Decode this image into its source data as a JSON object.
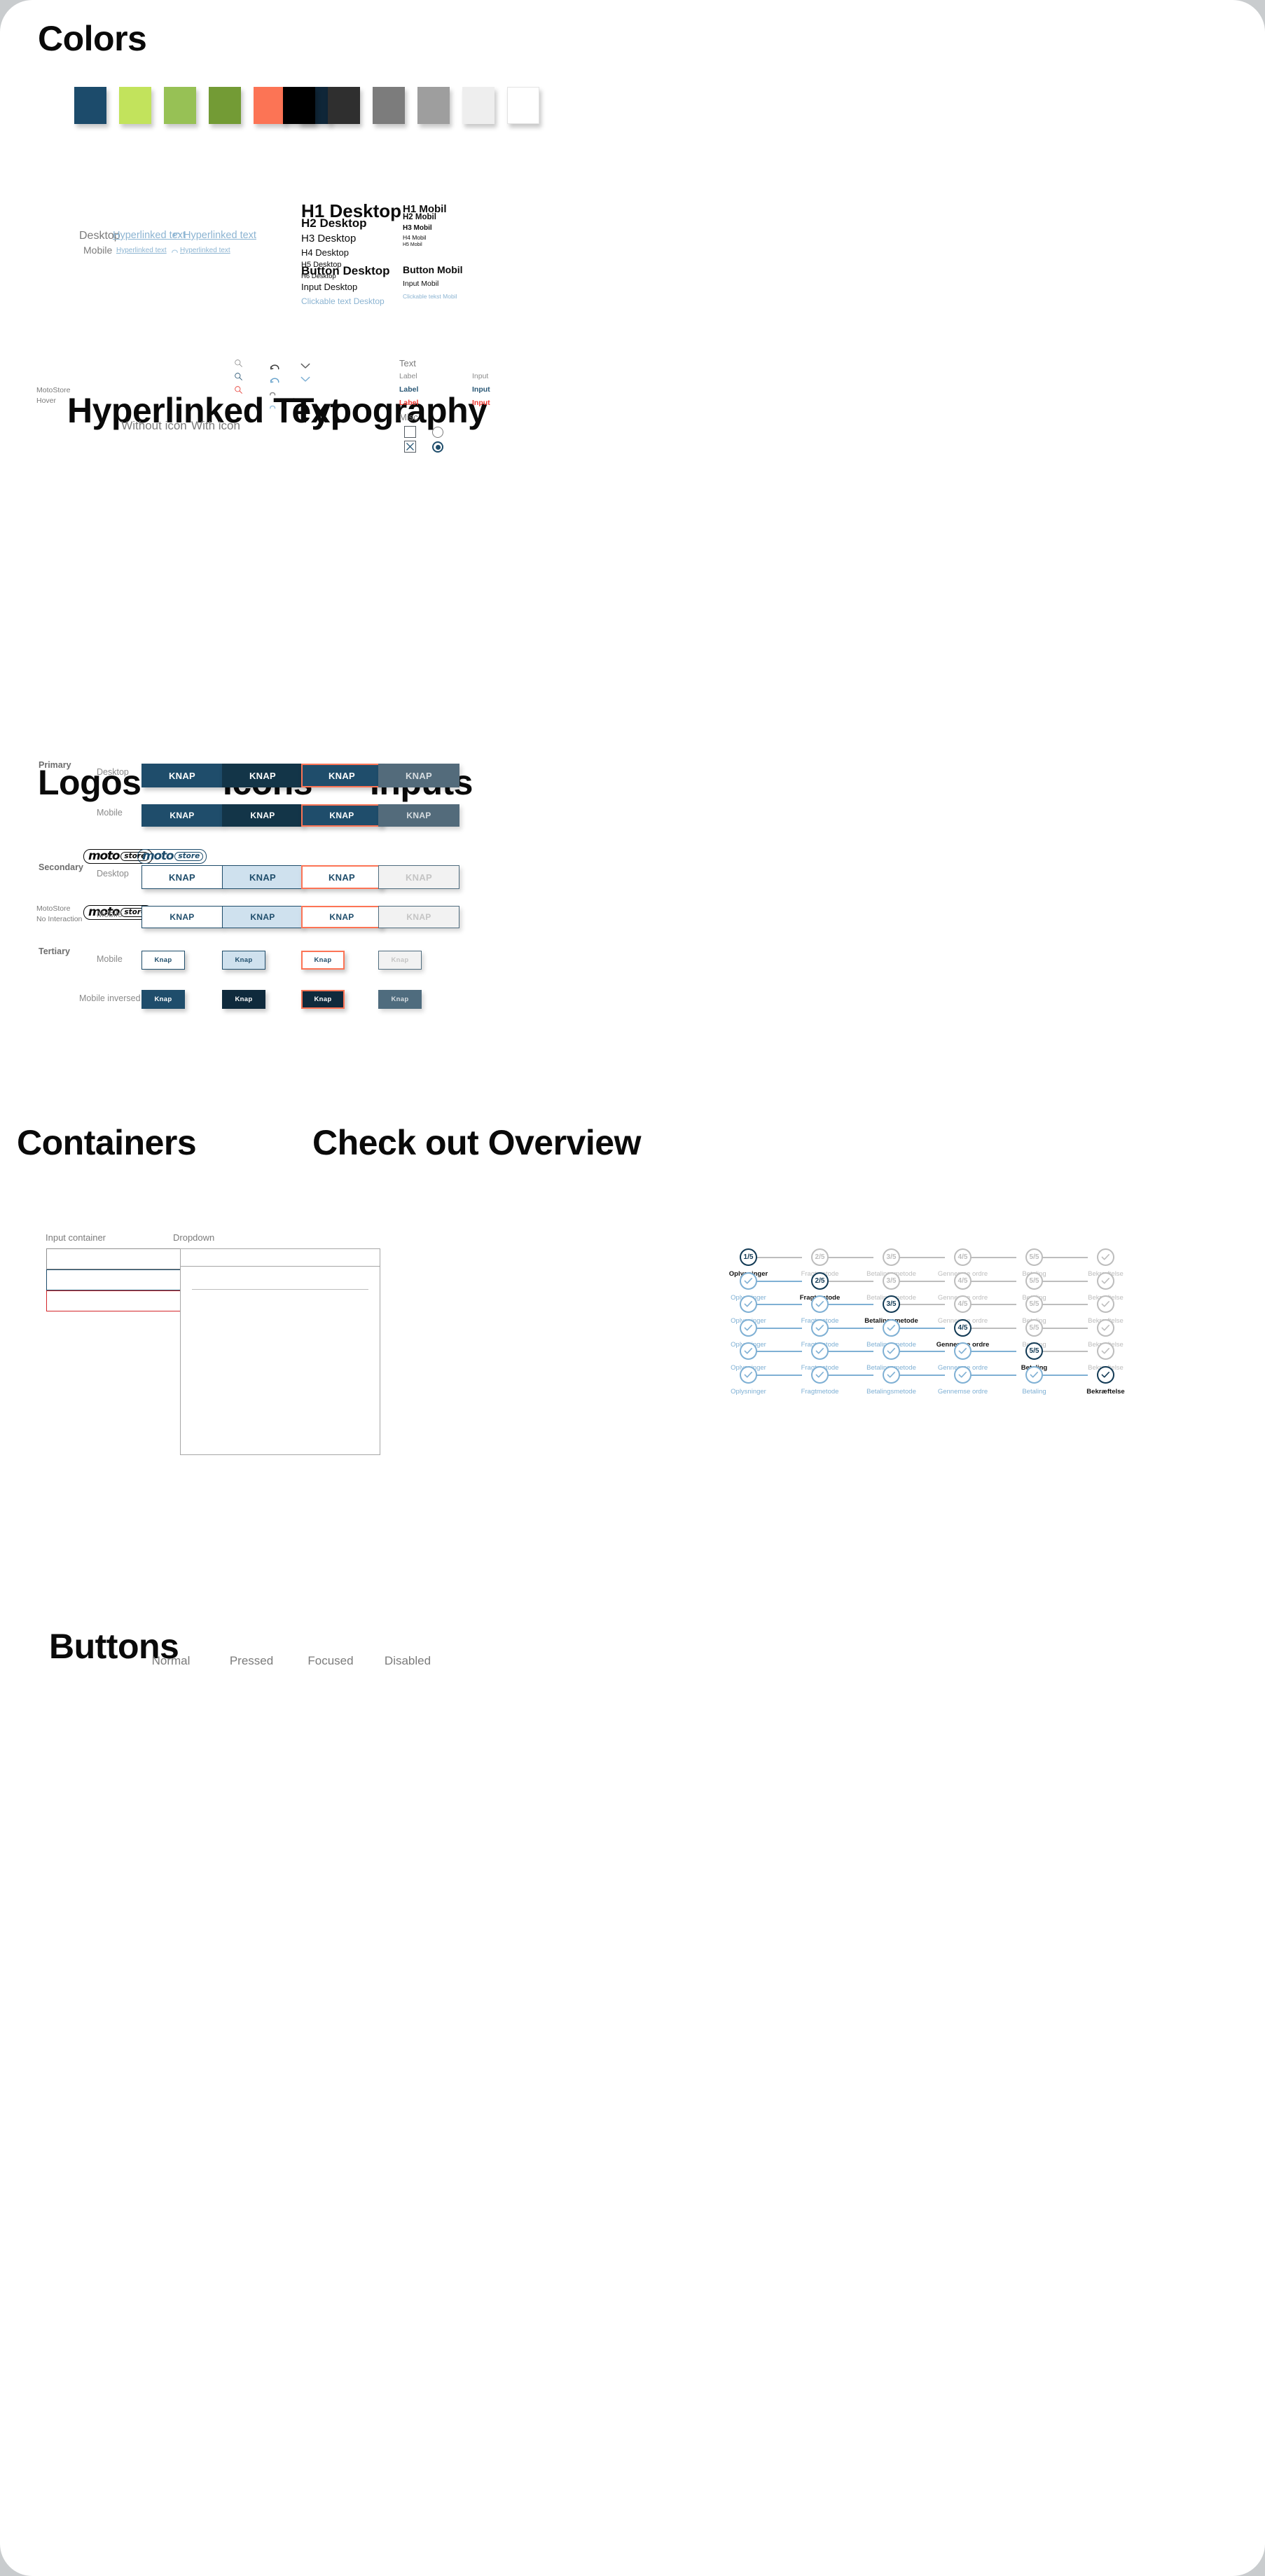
{
  "sections": {
    "colors": "Colors",
    "hyperlinked": "Hyperlinked Text",
    "typography": "Typography",
    "logos": "Logos",
    "icons": "Icons",
    "inputs": "Inputs",
    "containers": "Containers",
    "checkout": "Check out Overview",
    "buttons": "Buttons"
  },
  "colors": {
    "brand": [
      {
        "name": "navy-blue",
        "hex": "#1c4b6b"
      },
      {
        "name": "lime-green",
        "hex": "#c2e35c"
      },
      {
        "name": "apple-green",
        "hex": "#97c155"
      },
      {
        "name": "olive-green",
        "hex": "#739b35"
      },
      {
        "name": "coral-orange",
        "hex": "#fc7455"
      },
      {
        "name": "dark-navy",
        "hex": "#0f2638"
      }
    ],
    "neutrals": [
      {
        "name": "black",
        "hex": "#000000"
      },
      {
        "name": "near-black",
        "hex": "#2f2f2f"
      },
      {
        "name": "dark-grey",
        "hex": "#7c7c7c"
      },
      {
        "name": "mid-grey",
        "hex": "#9e9e9e"
      },
      {
        "name": "light-grey",
        "hex": "#eeeeee"
      },
      {
        "name": "white",
        "hex": "#ffffff"
      }
    ]
  },
  "hyperlinked": {
    "col_without": "Without icon",
    "col_with": "With icon",
    "row_desktop": "Desktop",
    "row_mobile": "Mobile",
    "link_text": "Hyperlinked text",
    "link_color": "#8cb4d2"
  },
  "typography": {
    "desktop": [
      {
        "label": "H1 Desktop",
        "size": 26,
        "weight": 700
      },
      {
        "label": "H2 Desktop",
        "size": 17,
        "weight": 700
      },
      {
        "label": "H3 Desktop",
        "size": 15,
        "weight": 400
      },
      {
        "label": "H4 Desktop",
        "size": 13,
        "weight": 400
      },
      {
        "label": "H5 Desktop",
        "size": 11,
        "weight": 400
      },
      {
        "label": "H6 Desktop",
        "size": 9.5,
        "weight": 400
      }
    ],
    "desktop_extra": [
      {
        "label": "Button Desktop",
        "size": 17,
        "weight": 700,
        "color": "#0c0c0c"
      },
      {
        "label": "Input Desktop",
        "size": 13,
        "weight": 400,
        "color": "#0c0c0c"
      },
      {
        "label": "Clickable text Desktop",
        "size": 12,
        "weight": 400,
        "color": "#8cb4d2"
      }
    ],
    "mobile": [
      {
        "label": "H1 Mobil",
        "size": 15,
        "weight": 700
      },
      {
        "label": "H2 Mobil",
        "size": 11.5,
        "weight": 700
      },
      {
        "label": "H3 Mobil",
        "size": 10,
        "weight": 700
      },
      {
        "label": "H4 Mobil",
        "size": 8.5,
        "weight": 400
      },
      {
        "label": "H5 Mobil",
        "size": 7,
        "weight": 400
      }
    ],
    "mobile_extra": [
      {
        "label": "Button Mobil",
        "size": 14,
        "weight": 700,
        "color": "#0c0c0c"
      },
      {
        "label": "Input Mobil",
        "size": 10.5,
        "weight": 400,
        "color": "#0c0c0c"
      },
      {
        "label": "Clickable tekst Mobil",
        "size": 8.5,
        "weight": 400,
        "color": "#8cb4d2"
      }
    ]
  },
  "logos": {
    "row_hover": "MotoStore\nHover",
    "row_hover_l1": "MotoStore",
    "row_hover_l2": "Hover",
    "row_none_l1": "MotoStore",
    "row_none_l2": "No Interaction",
    "wordmark": "moto",
    "badge": "store",
    "black": "#0a0a0a",
    "blue": "#1c4b6b"
  },
  "icons": {
    "search": [
      {
        "name": "search-icon-grey",
        "color": "#8a8a8a"
      },
      {
        "name": "search-icon-navy",
        "color": "#1c4b6b"
      },
      {
        "name": "search-icon-red",
        "color": "#e5332a"
      }
    ],
    "undo": [
      {
        "name": "undo-icon-dark",
        "color": "#3b3b3b",
        "scale": 1
      },
      {
        "name": "undo-icon-blue",
        "color": "#6aa4cc",
        "scale": 1
      },
      {
        "name": "undo-icon-grey-small",
        "color": "#8a8a8a",
        "scale": 0.62
      },
      {
        "name": "undo-icon-blue-small",
        "color": "#9cc3de",
        "scale": 0.62
      }
    ],
    "chevron": [
      {
        "name": "chevron-down-icon-grey",
        "color": "#5d5d5d"
      },
      {
        "name": "chevron-down-icon-blue",
        "color": "#7fb0d4"
      }
    ]
  },
  "inputs": {
    "group_text": "Text",
    "group_misc": "Misc",
    "rows": [
      {
        "label": "Label",
        "value": "Input",
        "color": "#8c8c8c"
      },
      {
        "label": "Label",
        "value": "Input",
        "color": "#2a5876"
      },
      {
        "label": "Label",
        "value": "Input",
        "color": "#ee3a33"
      }
    ],
    "checkbox_unchecked": "checkbox-unchecked",
    "checkbox_checked": "checkbox-checked-x",
    "radio_unchecked": "radio-unchecked",
    "radio_checked": "radio-checked"
  },
  "containers": {
    "input_label": "Input container",
    "dropdown_label": "Dropdown",
    "boxes": [
      {
        "name": "input-container-default",
        "border": "#8f8f8f"
      },
      {
        "name": "input-container-focus",
        "border": "#1c4b6b"
      },
      {
        "name": "input-container-error",
        "border": "#d4262a"
      }
    ]
  },
  "checkout": {
    "steps": [
      "Oplysninger",
      "Fragtmetode",
      "Betalingsmetode",
      "Gennemse ordre",
      "Betaling",
      "Bekræftelse"
    ],
    "fractions": [
      "1/5",
      "2/5",
      "3/5",
      "4/5",
      "5/5",
      "check"
    ],
    "current_index": [
      0,
      1,
      2,
      3,
      4,
      5
    ],
    "colors": {
      "current": "#123a55",
      "done": "#7fb0d4",
      "pending": "#bdbdbd"
    }
  },
  "buttons": {
    "columns": [
      "Normal",
      "Pressed",
      "Focused",
      "Disabled"
    ],
    "groups": [
      {
        "type": "Primary",
        "variants": [
          "Desktop",
          "Mobile"
        ]
      },
      {
        "type": "Secondary",
        "variants": [
          "Desktop",
          "Mobile"
        ]
      },
      {
        "type": "Tertiary",
        "variants": [
          "Mobile",
          "Mobile inversed"
        ]
      }
    ],
    "label_upper": "KNAP",
    "label_title": "Knap",
    "palette": {
      "primary_normal_bg": "#1f4d6b",
      "primary_pressed_bg": "#133548",
      "primary_focus_bg": "#1f4d6b",
      "primary_focus_border": "#fc7455",
      "primary_disabled_bg": "#536b7b",
      "primary_disabled_text": "#d7dde1",
      "secondary_border": "#1f4d6b",
      "secondary_text": "#1f4d6b",
      "secondary_pressed_bg": "#cfe1ee",
      "secondary_focus_border": "#fc7455",
      "secondary_disabled_bg": "#f2f2f2",
      "secondary_disabled_border": "#4f6c7e",
      "secondary_disabled_text": "#c4c4c4",
      "tertiary_inv_bg": "#1f4d6b",
      "tertiary_inv_pressed_bg": "#0f2a3c",
      "tertiary_inv_disabled_bg": "#4f6c7e"
    }
  }
}
